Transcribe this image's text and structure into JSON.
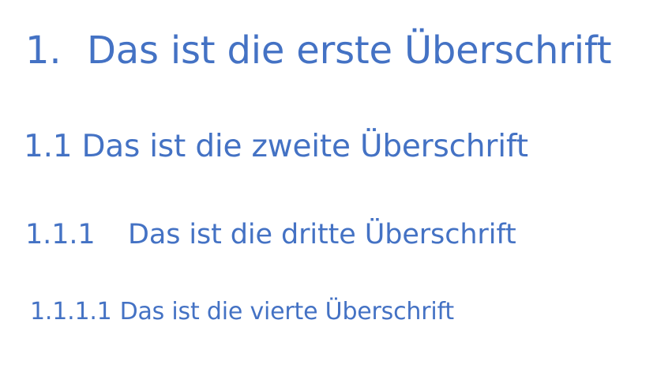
{
  "document": {
    "headings": [
      {
        "number": "1.",
        "text": "Das ist die erste Überschrift"
      },
      {
        "number": "1.1",
        "text": "Das ist die zweite Überschrift"
      },
      {
        "number": "1.1.1",
        "text": "Das ist die dritte Überschrift"
      },
      {
        "number": "1.1.1.1",
        "text": "Das ist die vierte Überschrift"
      }
    ]
  },
  "colors": {
    "heading_text": "#4472c4",
    "background": "#ffffff"
  }
}
